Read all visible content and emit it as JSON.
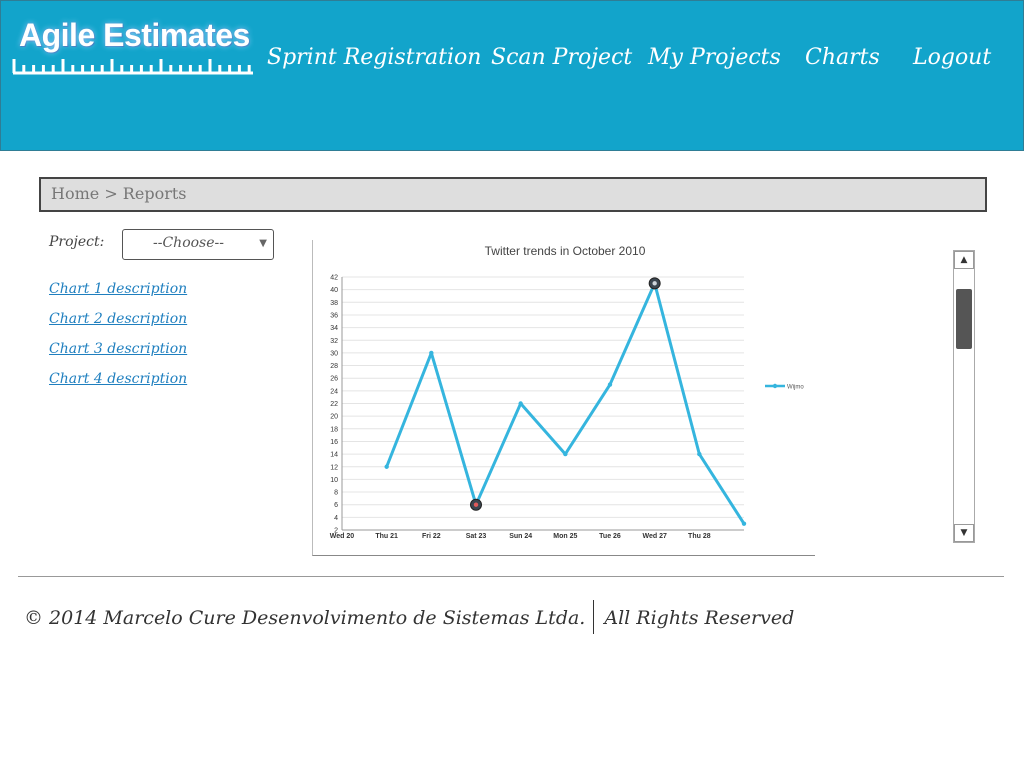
{
  "header": {
    "logo_text": "Agile Estimates",
    "nav": [
      "Sprint Registration",
      "Scan Project",
      "My Projects",
      "Charts",
      "Logout"
    ]
  },
  "breadcrumb": "Home > Reports",
  "project_filter": {
    "label": "Project:",
    "selected": "--Choose--"
  },
  "chart_links": [
    "Chart 1 description",
    "Chart 2 description",
    "Chart 3 description",
    "Chart 4 description"
  ],
  "footer": {
    "copyright": "© 2014 Marcelo Cure Desenvolvimento de Sistemas Ltda.",
    "rights": "All Rights Reserved"
  },
  "colors": {
    "header_bg": "#12a4cb",
    "line": "#35b5de",
    "link": "#1f7fbf"
  },
  "chart_data": {
    "type": "line",
    "title": "Twitter trends in October 2010",
    "categories": [
      "Wed 20",
      "Thu 21",
      "Fri 22",
      "Sat 23",
      "Sun 24",
      "Mon 25",
      "Tue 26",
      "Wed 27",
      "Thu 28"
    ],
    "series": [
      {
        "name": "Wijmo",
        "x": [
          1,
          2,
          3,
          4,
          5,
          6,
          7,
          8,
          9
        ],
        "values": [
          12,
          30,
          6,
          22,
          14,
          25,
          41,
          14,
          3
        ]
      }
    ],
    "ylim": [
      2,
      42
    ],
    "yticks": [
      2,
      4,
      6,
      8,
      10,
      12,
      14,
      16,
      18,
      20,
      22,
      24,
      26,
      28,
      30,
      32,
      34,
      36,
      38,
      40,
      42
    ],
    "grid": true,
    "legend": "right",
    "markers": {
      "min_point": "Sat 23",
      "max_point": "Wed 27"
    }
  }
}
